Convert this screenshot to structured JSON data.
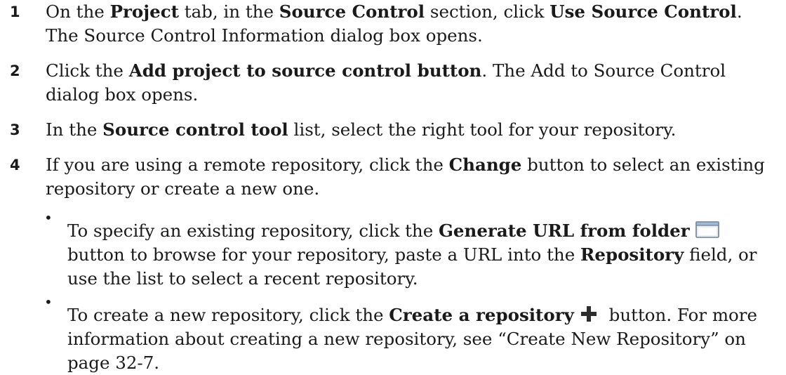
{
  "steps": [
    {
      "number": "1",
      "parts": [
        "On the ",
        "Project",
        " tab, in the ",
        "Source Control",
        " section, click ",
        "Use Source Control",
        ". The Source Control Information dialog box opens."
      ]
    },
    {
      "number": "2",
      "parts": [
        "Click the ",
        "Add project to source control button",
        ". The Add to Source Control dialog box opens."
      ]
    },
    {
      "number": "3",
      "parts": [
        "In the ",
        "Source control tool",
        " list, select the right tool for your repository."
      ]
    },
    {
      "number": "4",
      "parts": [
        "If you are using a remote repository, click the ",
        "Change",
        " button to select an existing repository or create a new one."
      ]
    }
  ],
  "bullets": [
    {
      "bullet": "•",
      "parts": [
        "To specify an existing repository, click the ",
        "Generate URL from folder",
        " button to browse for your repository, paste a URL into the ",
        "Repository",
        " field, or use the list to select a recent repository."
      ],
      "icon": "folder-icon"
    },
    {
      "bullet": "•",
      "parts": [
        "To create a new repository, click the ",
        "Create a repository",
        " button. For more information about creating a new repository, see “Create New Repository” on page 32-7."
      ],
      "icon": "plus-icon"
    }
  ]
}
